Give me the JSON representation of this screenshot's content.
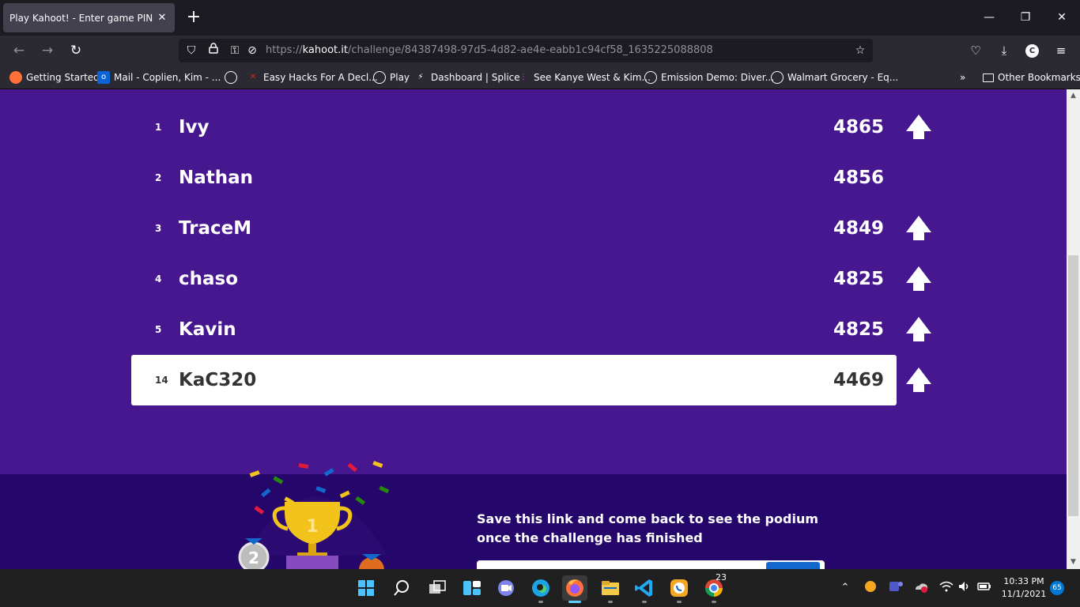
{
  "browser": {
    "tab_title": "Play Kahoot! - Enter game PIN here!",
    "tab_close": "✕",
    "new_tab": "+",
    "url_prefix": "https://",
    "url_host": "kahoot.it",
    "url_path": "/challenge/84387498-97d5-4d82-ae4e-eabb1c94cf58_1635225088808",
    "profile_initial": "C",
    "bookmarks": [
      {
        "label": "Getting Started"
      },
      {
        "label": "Mail - Coplien, Kim - ..."
      },
      {
        "label": ""
      },
      {
        "label": "Easy Hacks For A Decl..."
      },
      {
        "label": "Play"
      },
      {
        "label": "Dashboard | Splice"
      },
      {
        "label": "See Kanye West & Kim..."
      },
      {
        "label": "Emission Demo: Diver..."
      },
      {
        "label": "Walmart Grocery - Eq..."
      }
    ],
    "other_bookmarks": "Other Bookmarks"
  },
  "leaderboard": [
    {
      "rank": "1",
      "name": "Ivy",
      "score": "4865",
      "arrow": true
    },
    {
      "rank": "2",
      "name": "Nathan",
      "score": "4856",
      "arrow": false
    },
    {
      "rank": "3",
      "name": "TraceM",
      "score": "4849",
      "arrow": true
    },
    {
      "rank": "4",
      "name": "chaso",
      "score": "4825",
      "arrow": true
    },
    {
      "rank": "5",
      "name": "Kavin",
      "score": "4825",
      "arrow": true
    },
    {
      "rank": "14",
      "name": "KaC320",
      "score": "4469",
      "arrow": true
    }
  ],
  "footer": {
    "save_text": "Save this link and come back to see the podium once the challenge has finished",
    "podium_second": "2",
    "podium_first": "1"
  },
  "taskbar": {
    "chrome_badge": "23",
    "time": "10:33 PM",
    "date": "11/1/2021",
    "notification_count": "65"
  },
  "colors": {
    "page_bg": "#46178f",
    "footer_bg": "#25076b",
    "highlight_row": "#ffffff"
  }
}
